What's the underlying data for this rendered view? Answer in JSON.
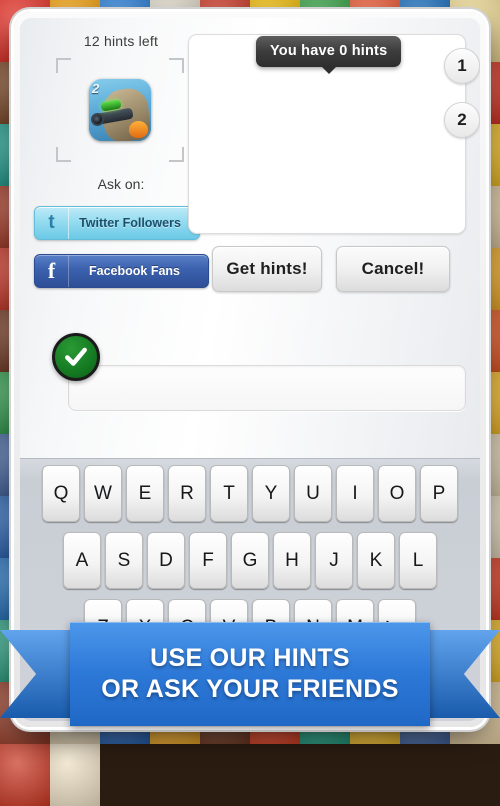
{
  "background": {
    "description": "app-icon-collage",
    "tile_colors": [
      "#d9342b",
      "#f0a61e",
      "#2f7fd1",
      "#e8e2d4",
      "#c23a2a",
      "#f2c21a",
      "#3fa34d",
      "#e45c3a",
      "#1f6fb8",
      "#f4e1a1",
      "#7a4a2b",
      "#d8452f",
      "#2d8f6f",
      "#f39c12",
      "#b0342c",
      "#e7d9c3",
      "#3b5ea8",
      "#f6d02f",
      "#8e4b2e",
      "#cf3b2a",
      "#2a9d8f",
      "#f7b733",
      "#4a6fa5",
      "#e2c391",
      "#b5341f",
      "#f0e4cf",
      "#2f6fae",
      "#dd5a2f",
      "#3fa24a",
      "#f3c63b",
      "#9c3b28",
      "#e8d5b7",
      "#2b6fc2",
      "#f2a33c",
      "#7b3f2a",
      "#d44430",
      "#38a169",
      "#f6cb45",
      "#44608f",
      "#e6d3ae",
      "#c0392b",
      "#efe0c6",
      "#2e79b5",
      "#e06a2e",
      "#35955b",
      "#f4bb2a",
      "#8a3f2c",
      "#e9dcc1",
      "#305fa8",
      "#f1b33a",
      "#6f3b26",
      "#d24a2d",
      "#2fa08a",
      "#f5c948",
      "#4b6ba0",
      "#e4cfa8",
      "#b93a25",
      "#ece0cb",
      "#2c74b8",
      "#df5f31",
      "#3a9d55",
      "#f2c13c",
      "#933d2a",
      "#e7d7bb",
      "#2f66b0",
      "#f0aa33",
      "#74402c",
      "#d6462f",
      "#33a07d",
      "#f6c23e",
      "#46659a",
      "#e3cca4",
      "#be3b27",
      "#eee2cd",
      "#2a70b2",
      "#e2652f",
      "#389a60",
      "#f3bf3a",
      "#8d3c28",
      "#e8dabd",
      "#2d63ab",
      "#efb237",
      "#703d29",
      "#d3482e",
      "#31a288",
      "#f5c545",
      "#49699e",
      "#e5cfa6",
      "#bb3826",
      "#ede1c9",
      "#2b72b6",
      "#e1612f",
      "#369c58",
      "#f1c03b",
      "#913b29",
      "#e6d8ba",
      "#3166ae",
      "#f0ae35",
      "#72402b",
      "#d5452e",
      "#35a184",
      "#f6c742",
      "#47679c",
      "#e4cea7",
      "#bd3a26",
      "#eee3cc",
      "#2d75ba",
      "#e36630",
      "#3b9f5d",
      "#f4c43d",
      "#8f3e2b",
      "#e9dbbe",
      "#2e64ad",
      "#f1b139",
      "#6e3c27",
      "#d2472d",
      "#30a186",
      "#f5c644",
      "#4a6aa0",
      "#e5d0a9",
      "#b93927",
      "#ece0c8"
    ]
  },
  "hints": {
    "hints_left_label": "12 hints left",
    "ask_on_label": "Ask on:",
    "tooltip": "You have 0 hints",
    "app_icon_badge": "2",
    "twitter": {
      "label": "Twitter Followers",
      "glyph": "t"
    },
    "facebook": {
      "label": "Facebook Fans",
      "glyph": "f"
    },
    "get_hints_label": "Get hints!",
    "cancel_label": "Cancel!",
    "badges": [
      "1",
      "2"
    ]
  },
  "answer": {
    "input_value": "",
    "input_placeholder": ""
  },
  "keyboard": {
    "row1": [
      "Q",
      "W",
      "E",
      "R",
      "T",
      "Y",
      "U",
      "I",
      "O",
      "P"
    ],
    "row2": [
      "A",
      "S",
      "D",
      "F",
      "G",
      "H",
      "J",
      "K",
      "L"
    ],
    "row3": [
      "Z",
      "X",
      "C",
      "V",
      "B",
      "N",
      "M"
    ],
    "backspace": "backspace"
  },
  "ribbon": {
    "line1": "USE OUR HINTS",
    "line2": "OR ASK YOUR FRIENDS"
  },
  "colors": {
    "ribbon_blue": "#2d79d8",
    "facebook_blue": "#3b60ad",
    "twitter_blue": "#95dcf0",
    "check_green": "#157a22",
    "tooltip_gray": "#3c3c3c"
  }
}
